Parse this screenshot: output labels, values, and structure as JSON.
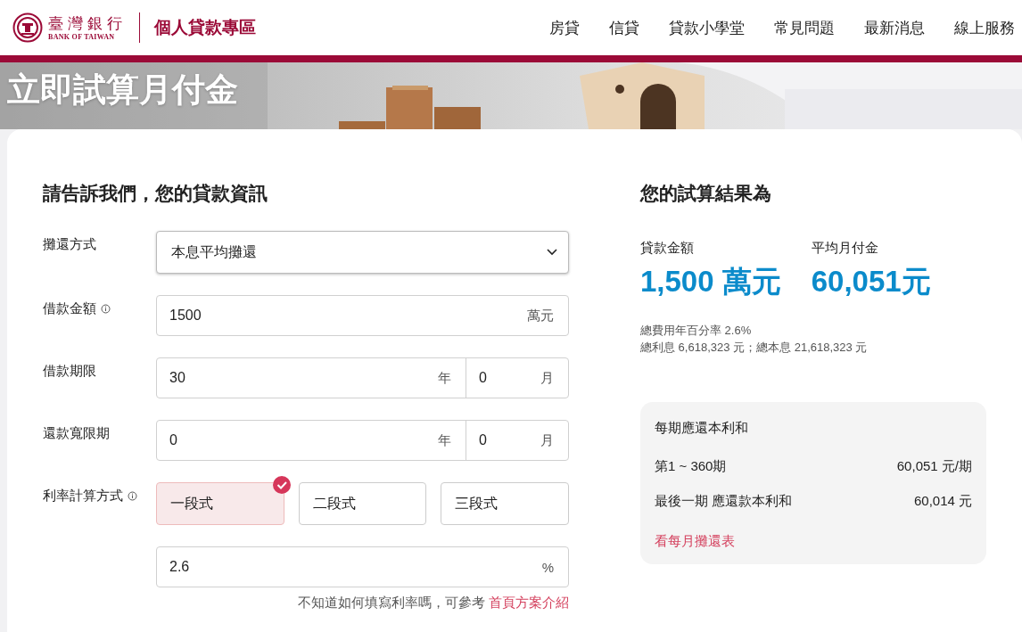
{
  "header": {
    "logo_name": "臺灣銀行",
    "logo_english": "BANK OF TAIWAN",
    "site_title": "個人貸款專區",
    "nav": [
      "房貸",
      "信貸",
      "貸款小學堂",
      "常見問題",
      "最新消息",
      "線上服務"
    ]
  },
  "hero": {
    "title": "立即試算月付金",
    "kind": "picture"
  },
  "form": {
    "title": "請告訴我們，您的貸款資訊",
    "fields": [
      {
        "kind": "select",
        "label": "攤還方式",
        "info": false,
        "value": "本息平均攤還"
      },
      {
        "kind": "unit",
        "label": "借款金額",
        "info": true,
        "value": "1500",
        "unit": "萬元"
      },
      {
        "kind": "split",
        "label": "借款期限",
        "info": false,
        "value": "30",
        "unit": "年",
        "value_2": "0",
        "unit_2": "月"
      },
      {
        "kind": "split",
        "label": "還款寬限期",
        "info": false,
        "value": "0",
        "unit": "年",
        "value_2": "0",
        "unit_2": "月"
      },
      {
        "kind": "choice",
        "label": "利率計算方式",
        "info": true,
        "options": [
          {
            "label": "一段式",
            "selected": true
          },
          {
            "label": "二段式",
            "selected": false
          },
          {
            "label": "三段式",
            "selected": false
          }
        ]
      },
      {
        "kind": "unit",
        "value": "2.6",
        "unit": "%"
      }
    ],
    "hint": "不知道如何填寫利率嗎，可參考",
    "hint_link": "首頁方案介紹"
  },
  "result": {
    "title": "您的試算結果為",
    "stats": [
      {
        "label": "貸款金額",
        "value": "1,500 萬元"
      },
      {
        "label": "平均月付金",
        "value": "60,051元"
      }
    ],
    "apr": "總費用年百分率 2.6%",
    "totals": "總利息 6,618,323 元；總本息 21,618,323 元",
    "schedule": {
      "title": "每期應還本利和",
      "rows": [
        {
          "label": "第1 ~ 360期",
          "value": "60,051 元/期"
        },
        {
          "label": "最後一期 應還款本利和",
          "value": "60,014 元"
        }
      ],
      "link": "看每月攤還表"
    }
  }
}
